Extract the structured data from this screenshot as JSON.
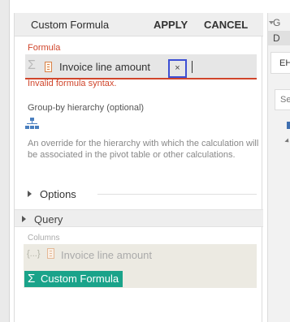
{
  "dialog": {
    "title": "Custom Formula",
    "apply_label": "APPLY",
    "cancel_label": "CANCEL"
  },
  "formula": {
    "label": "Formula",
    "token_text": "Invoice line amount",
    "clear_glyph": "×",
    "error": "Invalid formula syntax."
  },
  "group_by": {
    "label": "Group-by hierarchy (optional)",
    "description": "An override for the hierarchy with which the calculation will be associated in the pivot table or other calculations."
  },
  "options": {
    "label": "Options"
  },
  "query": {
    "label": "Query",
    "columns_label": "Columns",
    "column_item": "Invoice line amount",
    "fx_glyph": "{...}",
    "custom_formula_chip": "Custom Formula"
  },
  "side_panel": {
    "g_text": "G",
    "d_text": "D",
    "eh_text": "EH",
    "se_text": "Se"
  },
  "colors": {
    "error": "#d0452b",
    "accent_teal": "#1aa38a",
    "highlight_blue": "#3d4fd4"
  },
  "icons": {
    "sigma": "Σ",
    "file": "file-icon",
    "hierarchy": "hierarchy-icon"
  }
}
